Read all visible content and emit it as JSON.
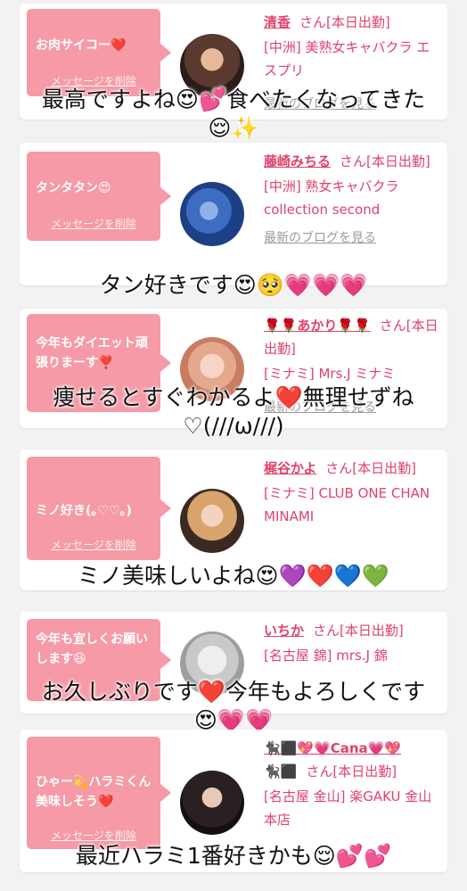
{
  "delete_label": "メッセージを削除",
  "blog_label": "最新のブログを見る",
  "cards": [
    {
      "message": "お肉サイコー❤️",
      "name": "清香",
      "status": "さん[本日出勤]",
      "shop": "[中洲] 美熟女キャバクラ エスプリ",
      "caption_line1": "最高ですよね😍💕食べたくなってきた",
      "caption_line2": "😌✨"
    },
    {
      "message": "タンタタン😍",
      "name": "藤崎みちる",
      "status": "さん[本日出勤]",
      "shop": "[中洲] 熟女キャバクラ collection second",
      "caption_line1": "タン好きです😍🥺💗💗💗",
      "caption_line2": ""
    },
    {
      "message": "今年もダイエット頑張りまーす❣️",
      "name": "🌹🌹あかり🌹🌹",
      "status": "さん[本日出勤]",
      "shop": "[ミナミ] Mrs.J ミナミ",
      "caption_line1": "痩せるとすぐわかるよ❤️無理せずね",
      "caption_line2": "♡(///ω///)"
    },
    {
      "message": "ミノ好き(｡♡♡｡)",
      "name": "梶谷かよ",
      "status": "さん[本日出勤]",
      "shop": "[ミナミ] CLUB ONE CHAN MINAMI",
      "caption_line1": "ミノ美味しいよね😍💜❤️💙💚",
      "caption_line2": ""
    },
    {
      "message": "今年も宜しくお願いします😆",
      "name": "いちか",
      "status": "さん[本日出勤]",
      "shop": "[名古屋 錦] mrs.J 錦",
      "caption_line1": "お久しぶりです❤️今年もよろしくです",
      "caption_line2": "😍💗💗"
    },
    {
      "message": "ひゃー💫ハラミくん美味しそう❤️",
      "name": "🐈‍⬛⬛💖💗Cana💗💖",
      "name2": "🐈‍⬛⬛",
      "status": "さん[本日出勤]",
      "shop": "[名古屋 金山] 楽GAKU 金山本店",
      "caption_line1": "最近ハラミ1番好きかも😌💕💕",
      "caption_line2": ""
    }
  ],
  "colors": {
    "bubble": "#f59aa6",
    "accent": "#e0426b",
    "background": "#f2f2f2"
  }
}
